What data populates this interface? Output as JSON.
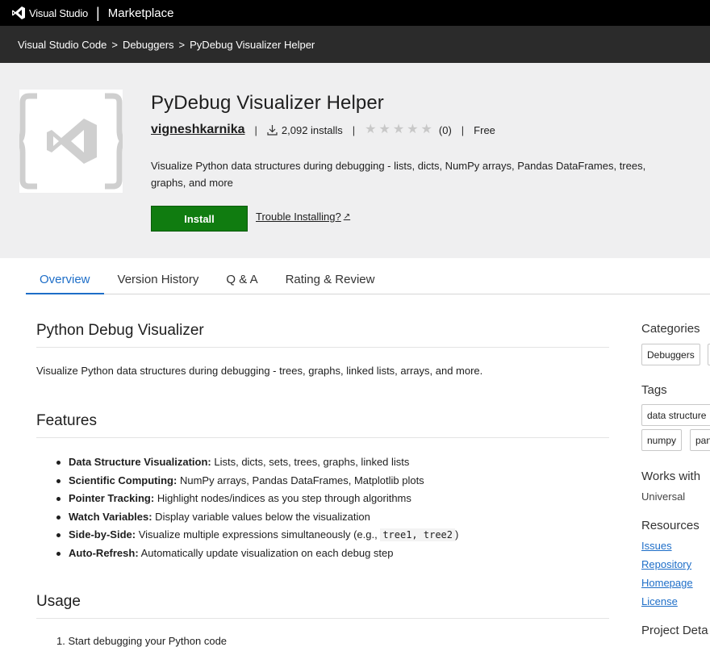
{
  "topbar": {
    "brand": "Visual Studio",
    "separator": "|",
    "marketplace": "Marketplace"
  },
  "breadcrumb": {
    "items": [
      "Visual Studio Code",
      "Debuggers",
      "PyDebug Visualizer Helper"
    ],
    "separator": ">"
  },
  "extension": {
    "title": "PyDebug Visualizer Helper",
    "publisher": "vigneshkarnika",
    "installs": "2,092 installs",
    "rating_count": "(0)",
    "rating_value": 0,
    "rating_max": 5,
    "price": "Free",
    "meta_separator": "|",
    "description": "Visualize Python data structures during debugging - lists, dicts, NumPy arrays, Pandas DataFrames, trees, graphs, and more",
    "install_label": "Install",
    "trouble_label": "Trouble Installing?",
    "icons": {
      "logo": "vs-code-icon",
      "install": "download-icon",
      "external": "external-link-icon",
      "star": "star-icon"
    }
  },
  "tabs": [
    {
      "label": "Overview",
      "active": true
    },
    {
      "label": "Version History",
      "active": false
    },
    {
      "label": "Q & A",
      "active": false
    },
    {
      "label": "Rating & Review",
      "active": false
    }
  ],
  "content": {
    "heading": "Python Debug Visualizer",
    "intro": "Visualize Python data structures during debugging - trees, graphs, linked lists, arrays, and more.",
    "features_heading": "Features",
    "features": [
      {
        "title": "Data Structure Visualization:",
        "text": " Lists, dicts, sets, trees, graphs, linked lists"
      },
      {
        "title": "Scientific Computing:",
        "text": " NumPy arrays, Pandas DataFrames, Matplotlib plots"
      },
      {
        "title": "Pointer Tracking:",
        "text": " Highlight nodes/indices as you step through algorithms"
      },
      {
        "title": "Watch Variables:",
        "text": " Display variable values below the visualization"
      },
      {
        "title": "Side-by-Side:",
        "text": " Visualize multiple expressions simultaneously (e.g., ",
        "code": "tree1, tree2",
        "after": ")"
      },
      {
        "title": "Auto-Refresh:",
        "text": " Automatically update visualization on each debug step"
      }
    ],
    "usage_heading": "Usage",
    "usage_first": "1. Start debugging your Python code"
  },
  "sidebar": {
    "categories_heading": "Categories",
    "categories": [
      "Debuggers"
    ],
    "tags_heading": "Tags",
    "tags": [
      "data structure",
      "numpy",
      "pan"
    ],
    "works_with_heading": "Works with",
    "works_with": "Universal",
    "resources_heading": "Resources",
    "resources": [
      "Issues",
      "Repository",
      "Homepage",
      "License"
    ],
    "project_heading": "Project Deta"
  },
  "colors": {
    "install_green": "#107c10",
    "tab_active": "#1e6ec8",
    "link": "#1e6ec8",
    "hero_bg": "#efeff0"
  }
}
